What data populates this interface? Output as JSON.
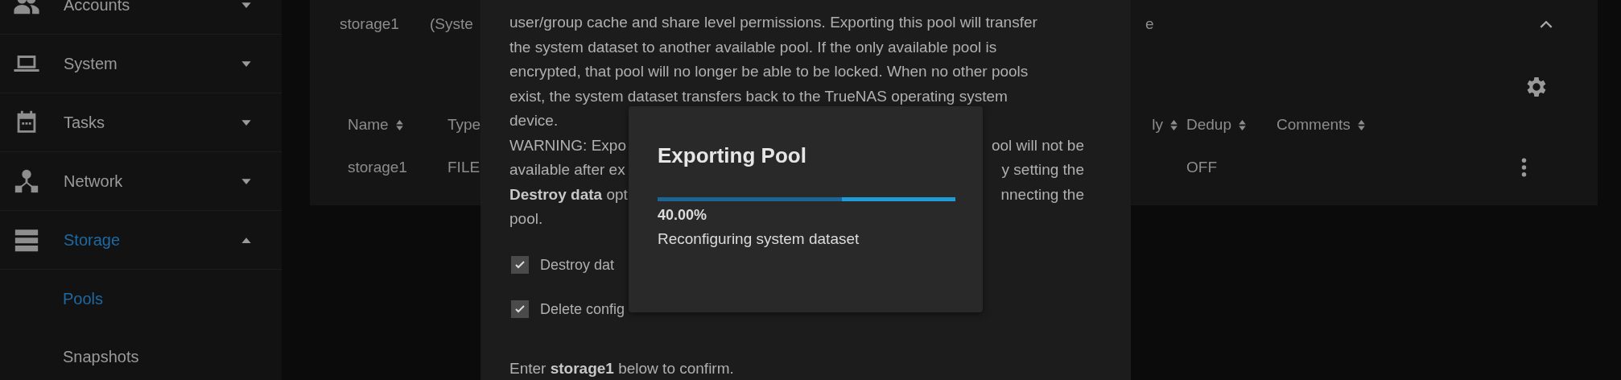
{
  "sidebar": {
    "items": [
      {
        "label": "Accounts",
        "selected": false,
        "expanded": false
      },
      {
        "label": "System",
        "selected": false,
        "expanded": false
      },
      {
        "label": "Tasks",
        "selected": false,
        "expanded": false
      },
      {
        "label": "Network",
        "selected": false,
        "expanded": false
      },
      {
        "label": "Storage",
        "selected": true,
        "expanded": true,
        "children": [
          {
            "label": "Pools",
            "selected": true
          },
          {
            "label": "Snapshots",
            "selected": false
          }
        ]
      }
    ]
  },
  "pool": {
    "name": "storage1",
    "status_fragment": "(Syste",
    "status_tail": "e",
    "expanded": true,
    "table": {
      "columns": [
        {
          "label": "Name",
          "sortable": true
        },
        {
          "label": "Type",
          "sortable": false
        },
        {
          "label": "ly",
          "sortable": true
        },
        {
          "label": "Dedup",
          "sortable": true
        },
        {
          "label": "Comments",
          "sortable": true
        }
      ],
      "rows": [
        {
          "name": "storage1",
          "type": "FILE",
          "dedup": "OFF"
        }
      ]
    }
  },
  "export_dialog": {
    "lines": [
      {
        "left": "user/group cache and share level permissions. Exporting this pool will transfer"
      },
      {
        "left": "the system dataset to another available pool. If the only available pool is"
      },
      {
        "left": "encrypted, that pool will no longer be able to be locked. When no other pools"
      },
      {
        "left": "exist, the system dataset transfers back to the TrueNAS operating system"
      },
      {
        "left": "device."
      },
      {
        "left": "WARNING: Expo",
        "right": "ool will not be"
      },
      {
        "left": "available after ex",
        "right": "y setting the"
      },
      {
        "left": "**Destroy data** opt",
        "right": "nnecting the"
      },
      {
        "left": "pool."
      }
    ],
    "checkboxes": [
      {
        "label": "Destroy dat",
        "checked": true
      },
      {
        "label": "Delete config",
        "checked": true
      }
    ],
    "confirm_text": "Enter **storage1** below to confirm."
  },
  "progress_dialog": {
    "title": "Exporting Pool",
    "level": 0.62,
    "percent": "40.00%",
    "message": "Reconfiguring system dataset"
  }
}
